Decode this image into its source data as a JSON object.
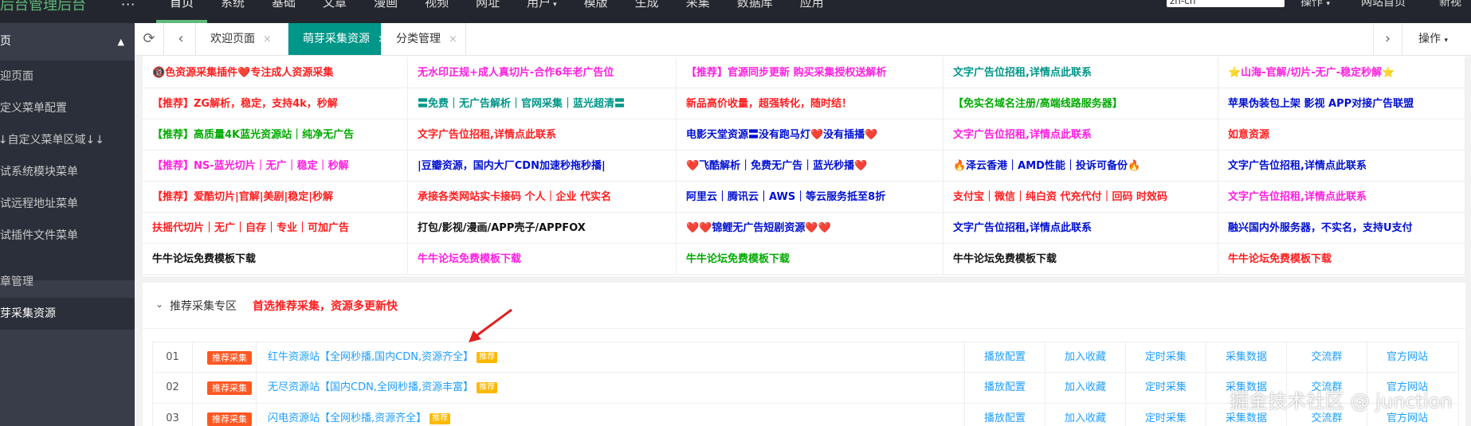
{
  "topbar": {
    "logo": "后台管理后台",
    "more": "···",
    "nav": [
      {
        "label": "首页",
        "active": true
      },
      {
        "label": "系统"
      },
      {
        "label": "基础"
      },
      {
        "label": "文章"
      },
      {
        "label": "漫画"
      },
      {
        "label": "视频"
      },
      {
        "label": "网址"
      },
      {
        "label": "用户",
        "caret": true
      },
      {
        "label": "模版"
      },
      {
        "label": "生成"
      },
      {
        "label": "采集"
      },
      {
        "label": "数据库"
      },
      {
        "label": "应用"
      }
    ],
    "lang": "zh-cn",
    "ops": "操作",
    "site_home": "网站首页",
    "new_window": "新视"
  },
  "sidebar": {
    "group": "首页",
    "items": [
      "欢迎页面",
      "自定义菜单配置",
      "↓↓自定义菜单区域↓↓",
      "测试系统模块菜单",
      "测试远程地址菜单",
      "测试插件文件菜单"
    ],
    "article": "文章管理",
    "current": "萌芽采集资源"
  },
  "tabs": {
    "items": [
      "欢迎页面",
      "萌芽采集资源",
      "分类管理"
    ],
    "close": "×",
    "ops": "操作"
  },
  "ads": {
    "rows": [
      [
        {
          "text": "🔞色资源采集插件❤️专注成人资源采集",
          "color": "#ff1e1e"
        },
        {
          "text": "无水印正规+成人真切片-合作6年老广告位",
          "color": "#ff1ee0"
        },
        {
          "text": "【推荐】官源同步更新 购买采集授权送解析",
          "color": "#ff1ee0"
        },
        {
          "text": "文字广告位招租,详情点此联系",
          "color": "#009688"
        },
        {
          "text": "⭐山海-官解/切片-无广-稳定秒解⭐",
          "color": "#ff1ee0"
        }
      ],
      [
        {
          "text": "【推荐】ZG解析，稳定，支持4k，秒解",
          "color": "#ff1e1e"
        },
        {
          "text": "〓免费｜无广告解析｜官网采集｜蓝光超清〓",
          "color": "#009688"
        },
        {
          "text": "新品高价收量，超强转化，随时结！",
          "color": "#ff1e1e"
        },
        {
          "text": "【免实名域名注册/高端线路服务器】",
          "color": "#00aa00"
        },
        {
          "text": "苹果伪装包上架 影视 APP对接广告联盟",
          "color": "#0010d0"
        }
      ],
      [
        {
          "text": "【推荐】高质量4K蓝光资源站｜纯净无广告",
          "color": "#00aa00"
        },
        {
          "text": "文字广告位招租,详情点此联系",
          "color": "#ff1e1e"
        },
        {
          "text": "电影天堂资源〓没有跑马灯❤️没有插播❤️",
          "color": "#0010d0"
        },
        {
          "text": "文字广告位招租,详情点此联系",
          "color": "#ff1ee0"
        },
        {
          "text": "如意资源",
          "color": "#ff1e1e"
        }
      ],
      [
        {
          "text": "【推荐】NS-蓝光切片｜无广｜稳定｜秒解",
          "color": "#ff1ee0"
        },
        {
          "text": "|豆瓣资源，国内大厂CDN加速秒拖秒播|",
          "color": "#0010d0"
        },
        {
          "text": "❤️飞酷解析｜免费无广告｜蓝光秒播❤️",
          "color": "#0010d0"
        },
        {
          "text": "🔥泽云香港｜AMD性能｜投诉可备份🔥",
          "color": "#0010d0"
        },
        {
          "text": "文字广告位招租,详情点此联系",
          "color": "#0010d0"
        }
      ],
      [
        {
          "text": "【推荐】爱酷切片|官解|美剧|稳定|秒解",
          "color": "#ff1e1e"
        },
        {
          "text": "承接各类网站实卡接码 个人｜企业 代实名",
          "color": "#ff1e1e"
        },
        {
          "text": "阿里云｜腾讯云｜AWS｜等云服务抵至8折",
          "color": "#0010d0"
        },
        {
          "text": "支付宝｜微信｜纯白资 代充代付｜回码 时效码",
          "color": "#ff1e1e"
        },
        {
          "text": "文字广告位招租,详情点此联系",
          "color": "#ff1ee0"
        }
      ],
      [
        {
          "text": "扶摇代切片｜无广｜自存｜专业｜可加广告",
          "color": "#ff1e1e"
        },
        {
          "text": "打包/影视/漫画/APP壳子/APPFOX",
          "color": "#111111"
        },
        {
          "text": "❤️❤️锦鲤无广告短剧资源❤️❤️",
          "color": "#0010d0"
        },
        {
          "text": "文字广告位招租,详情点此联系",
          "color": "#0010d0"
        },
        {
          "text": "融兴国内外服务器，不实名，支持U支付",
          "color": "#0010d0"
        }
      ],
      [
        {
          "text": "牛牛论坛免费模板下载",
          "color": "#111111"
        },
        {
          "text": "牛牛论坛免费模板下载",
          "color": "#ff1ee0"
        },
        {
          "text": "牛牛论坛免费模板下载",
          "color": "#00aa00"
        },
        {
          "text": "牛牛论坛免费模板下载",
          "color": "#111111"
        },
        {
          "text": "牛牛论坛免费模板下载",
          "color": "#ff1e1e"
        }
      ]
    ]
  },
  "section": {
    "title": "推荐采集专区",
    "subtitle": "首选推荐采集，资源多更新快"
  },
  "list": {
    "rows": [
      {
        "num": "01",
        "badge": "推荐采集",
        "title": "红牛资源站【全网秒播,国内CDN,资源齐全】",
        "tag": "推荐"
      },
      {
        "num": "02",
        "badge": "推荐采集",
        "title": "无尽资源站【国内CDN,全网秒播,资源丰富】",
        "tag": "推荐"
      },
      {
        "num": "03",
        "badge": "推荐采集",
        "title": "闪电资源站【全网秒播,资源齐全】",
        "tag": "推荐"
      }
    ],
    "actions": [
      "播放配置",
      "加入收藏",
      "定时采集",
      "采集数据",
      "交流群",
      "官方网站"
    ]
  },
  "watermark": "掘金技术社区 @ junction",
  "colors": {
    "topbar": "#23262e",
    "sidebar": "#393d49",
    "accent": "#009688",
    "link": "#1e9fff",
    "badge": "#ff5722",
    "tag": "#ffb800"
  },
  "icons": {
    "refresh": "refresh-icon",
    "prev": "chevron-left-icon",
    "next": "chevron-right-icon",
    "close": "close-icon",
    "collapse": "chevron-down-icon"
  }
}
